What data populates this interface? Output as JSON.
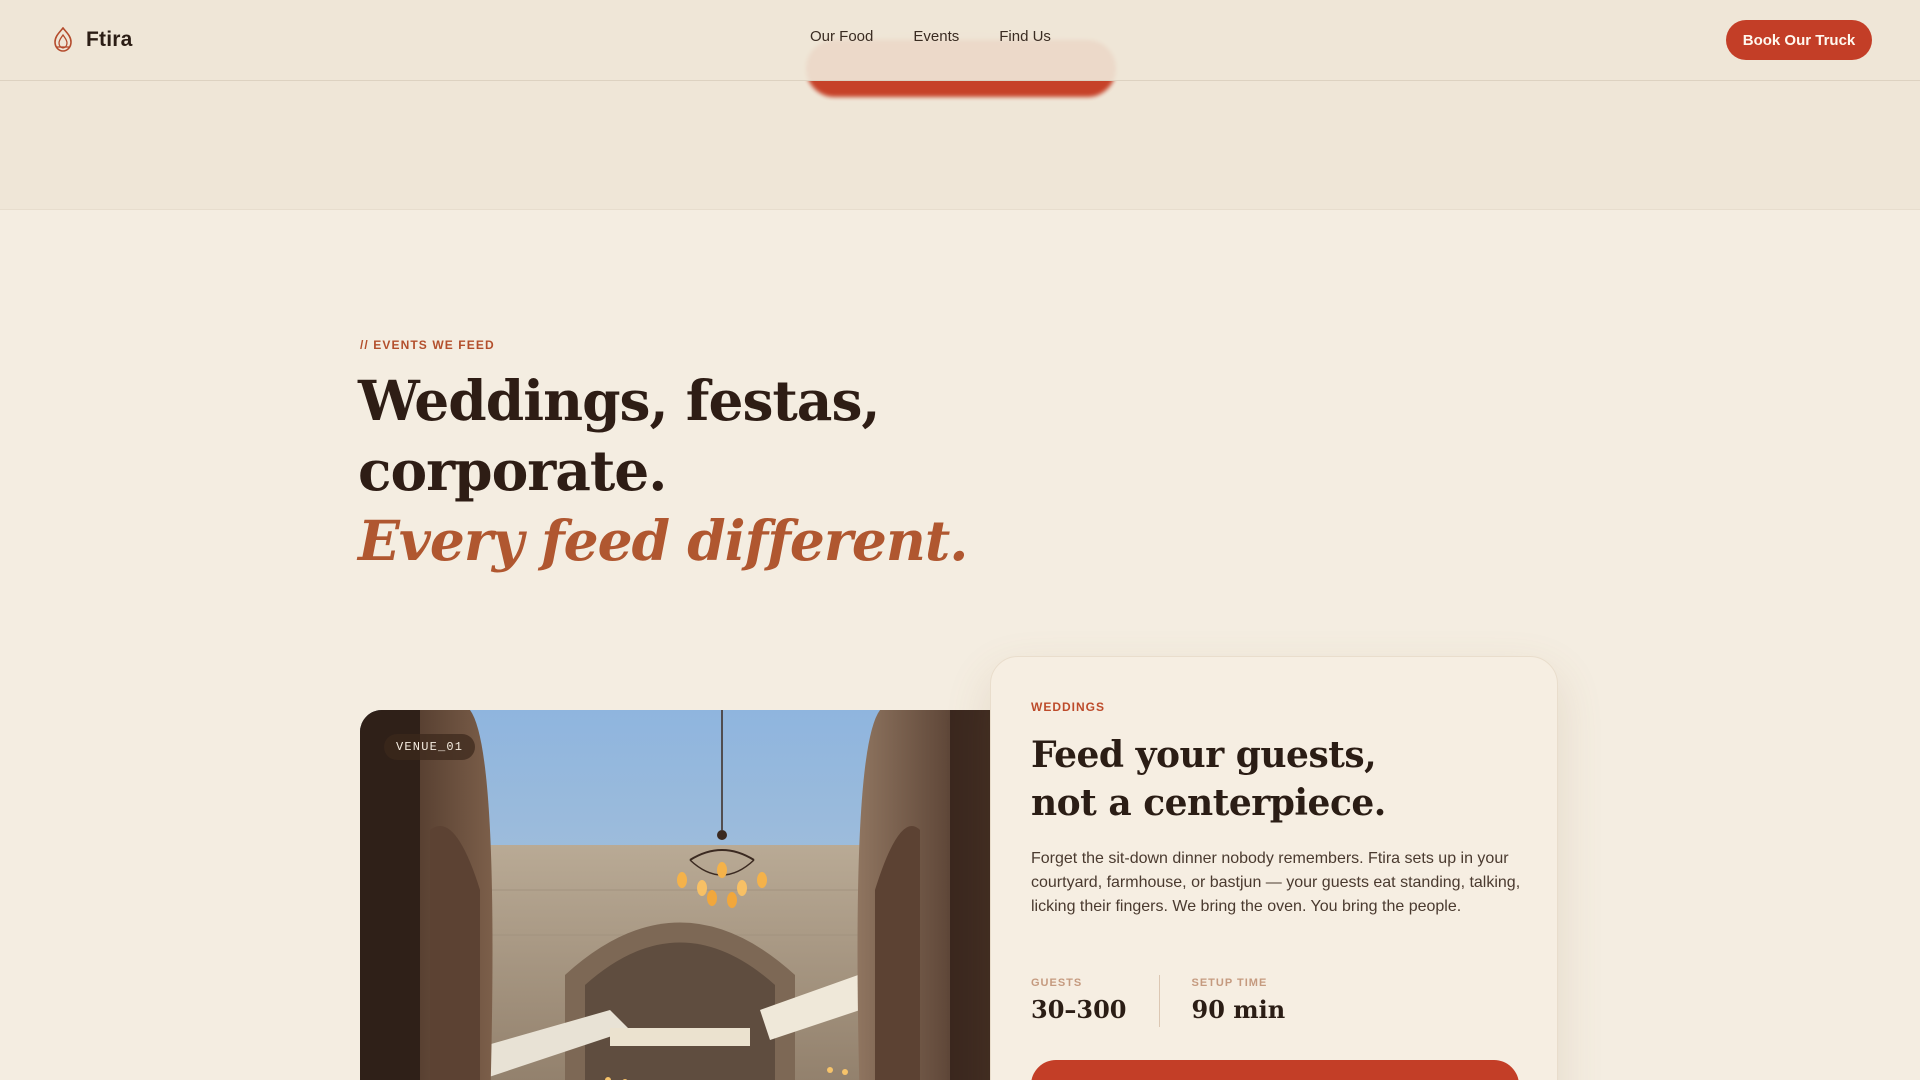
{
  "header": {
    "brand": "Ftira",
    "nav": [
      "Our Food",
      "Events",
      "Find Us"
    ],
    "cta": "Book Our Truck"
  },
  "section": {
    "eyebrow": "// EVENTS WE FEED",
    "headline": {
      "line1": "Weddings, festas,",
      "line2": "corporate.",
      "accent": "Every feed different."
    }
  },
  "venue": {
    "tag": "VENUE_01"
  },
  "card": {
    "eyebrow": "WEDDINGS",
    "title": {
      "line1": "Feed your guests,",
      "line2": "not a centerpiece."
    },
    "body": "Forget the sit-down dinner nobody remembers. Ftira sets up in your courtyard, farmhouse, or bastjun — your guests eat standing, talking, licking their fingers. We bring the oven. You bring the people.",
    "stats": [
      {
        "label": "GUESTS",
        "value": "30–300"
      },
      {
        "label": "SETUP TIME",
        "value": "90 min"
      }
    ]
  },
  "colors": {
    "background": "#f4ede1",
    "accent": "#c33e27",
    "text": "#2b1d15",
    "eyebrow": "#b34f2c",
    "italic_accent": "#b05730"
  },
  "icons": {
    "logo": "flame-logo-icon"
  }
}
